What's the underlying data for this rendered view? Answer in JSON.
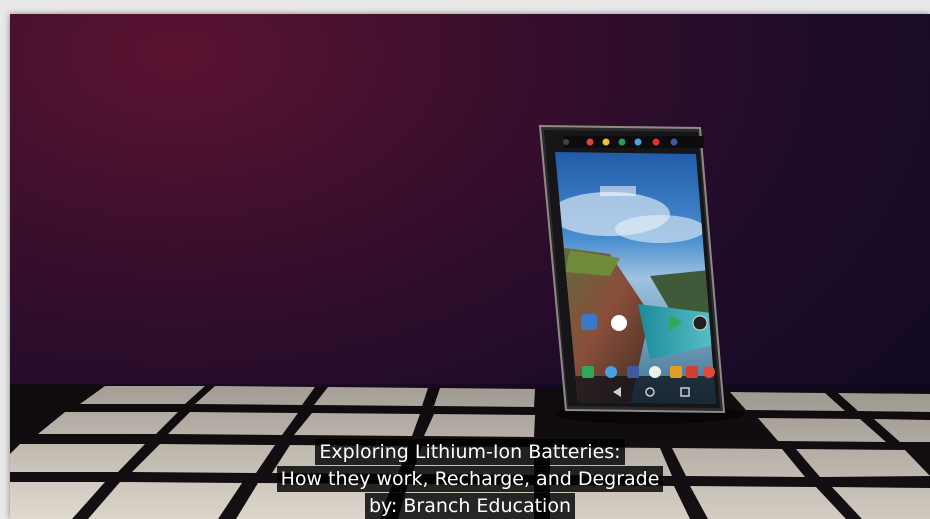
{
  "video": {
    "caption_lines": [
      "Exploring Lithium-Ion Batteries:",
      "How they work, Recharge, and Degrade",
      "by: Branch Education"
    ]
  },
  "scene": {
    "subject": "smartphone-on-grid-floor",
    "colors": {
      "background_glow": "#5a1330",
      "background_dark": "#0d0a22",
      "tile": "#d9d2c8",
      "grid_line": "#1a1414",
      "phone_frame": "#2a2a2c",
      "caption_bg": "#000000",
      "caption_text": "#ffffff"
    }
  }
}
